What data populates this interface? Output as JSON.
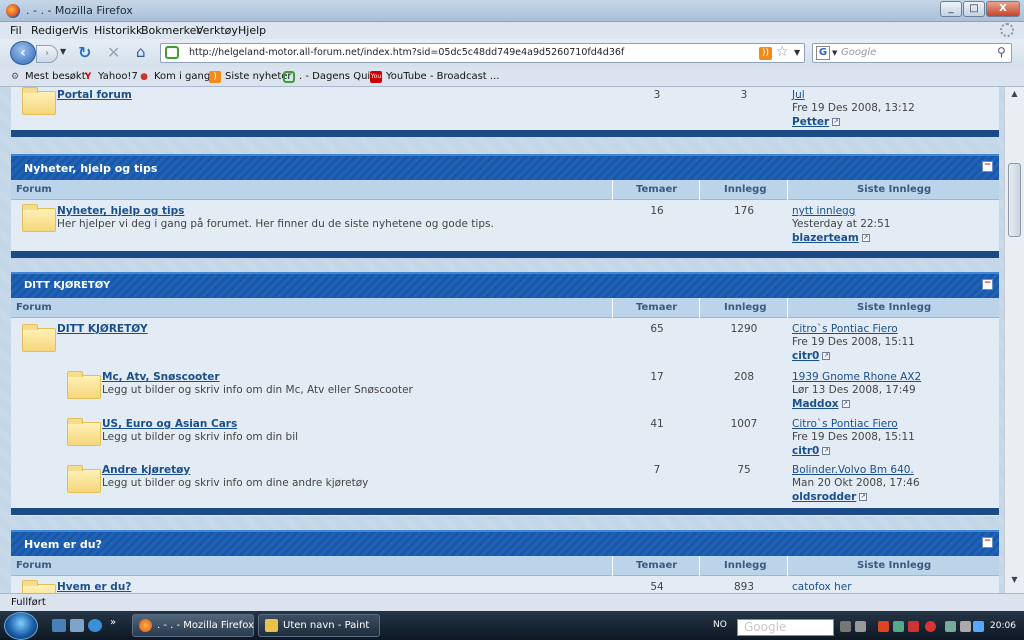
{
  "window": {
    "title": ". - . - Mozilla Firefox",
    "min": "_",
    "max": "□",
    "close": "X"
  },
  "menu": [
    "Fil",
    "Rediger",
    "Vis",
    "Historikk",
    "Bokmerker",
    "Verktøy",
    "Hjelp"
  ],
  "nav": {
    "url": "http://helgeland-motor.all-forum.net/index.htm?sid=05dc5c48dd749e4a9d5260710fd4d36f",
    "search_placeholder": "Google"
  },
  "bookmarks": [
    {
      "label": "Mest besøkt",
      "icon": "settings-icon"
    },
    {
      "label": "Yahoo!7",
      "icon": "yahoo-icon"
    },
    {
      "label": "Kom i gang",
      "icon": "red-bookmark-icon"
    },
    {
      "label": "Siste nyheter",
      "icon": "rss-icon"
    },
    {
      "label": ". - Dagens Quiz",
      "icon": "speech-bubble-icon"
    },
    {
      "label": "YouTube - Broadcast ...",
      "icon": "youtube-icon"
    }
  ],
  "forum": {
    "columns": {
      "forum": "Forum",
      "topics": "Temaer",
      "posts": "Innlegg",
      "last": "Siste Innlegg"
    },
    "portal_row": {
      "name": "Portal forum",
      "topics": "3",
      "posts": "3",
      "last_title": "Jul",
      "last_date": "Fre 19 Des 2008, 13:12",
      "last_user": "Petter"
    },
    "categories": [
      {
        "title": "Nyheter, hjelp og tips",
        "rows": [
          {
            "name": "Nyheter, hjelp og tips",
            "desc": "Her hjelper vi deg i gang på forumet. Her finner du de siste nyhetene og gode tips.",
            "topics": "16",
            "posts": "176",
            "last_title": "nytt innlegg",
            "last_date": "Yesterday at 22:51",
            "last_user": "blazerteam"
          }
        ]
      },
      {
        "title": "DITT KJØRETØY",
        "rows": [
          {
            "name": "DITT KJØRETØY",
            "desc": "",
            "topics": "65",
            "posts": "1290",
            "last_title": "Citro`s Pontiac Fiero",
            "last_date": "Fre 19 Des 2008, 15:11",
            "last_user": "citr0"
          },
          {
            "name": "Mc, Atv, Snøscooter",
            "desc": "Legg ut bilder og skriv info om din Mc, Atv eller Snøscooter",
            "topics": "17",
            "posts": "208",
            "last_title": "1939 Gnome Rhone AX2",
            "last_date": "Lør 13 Des 2008, 17:49",
            "last_user": "Maddox"
          },
          {
            "name": "US, Euro og Asian Cars",
            "desc": "Legg ut bilder og skriv info om din bil",
            "topics": "41",
            "posts": "1007",
            "last_title": "Citro`s Pontiac Fiero",
            "last_date": "Fre 19 Des 2008, 15:11",
            "last_user": "citr0"
          },
          {
            "name": "Andre kjøretøy",
            "desc": "Legg ut bilder og skriv info om dine andre kjøretøy",
            "topics": "7",
            "posts": "75",
            "last_title": "Bolinder.Volvo Bm 640.",
            "last_date": "Man 20 Okt 2008, 17:46",
            "last_user": "oldsrodder"
          }
        ]
      },
      {
        "title": "Hvem er du?",
        "rows": [
          {
            "name": "Hvem er du?",
            "desc": "",
            "topics": "54",
            "posts": "893",
            "last_title": "catofox her",
            "last_date": "",
            "last_user": ""
          }
        ]
      }
    ]
  },
  "status": "Fullført",
  "taskbar": {
    "tasks": [
      ". - . - Mozilla Firefox",
      "Uten navn - Paint"
    ],
    "lang": "NO",
    "search": "Google",
    "clock": "20:06"
  }
}
